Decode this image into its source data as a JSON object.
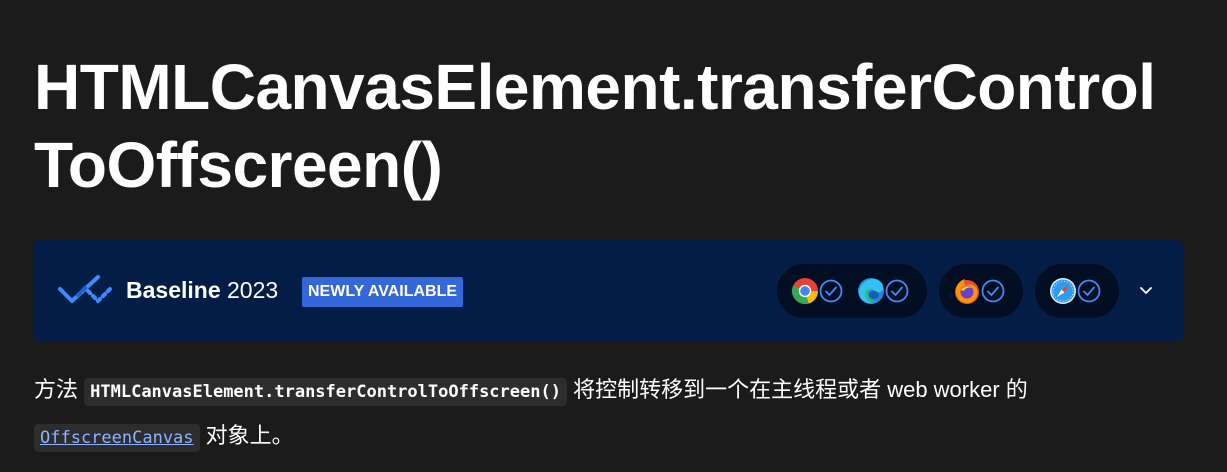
{
  "page": {
    "title": "HTMLCanvasElement.transferControlToOffscreen()"
  },
  "baseline": {
    "label_bold": "Baseline",
    "year": "2023",
    "badge": "NEWLY AVAILABLE",
    "browsers": [
      {
        "name": "chrome-icon",
        "status": "supported"
      },
      {
        "name": "edge-icon",
        "status": "supported"
      },
      {
        "name": "firefox-icon",
        "status": "supported"
      },
      {
        "name": "safari-icon",
        "status": "supported"
      }
    ],
    "colors": {
      "banner_bg": "#041d47",
      "badge_bg": "#3467d8",
      "check": "#3a8dff"
    }
  },
  "description": {
    "prefix": "方法",
    "method_code": "HTMLCanvasElement.transferControlToOffscreen()",
    "middle": "将控制转移到一个在主线程或者 web worker 的",
    "link_code": "OffscreenCanvas",
    "suffix": "对象上。"
  }
}
